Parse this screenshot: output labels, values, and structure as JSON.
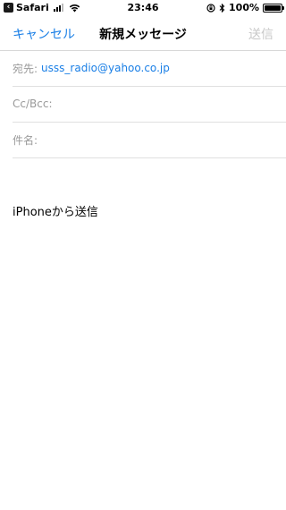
{
  "status_bar": {
    "back_app": "Safari",
    "time": "23:46",
    "battery": "100%"
  },
  "nav": {
    "cancel_label": "キャンセル",
    "title": "新規メッセージ",
    "send_label": "送信"
  },
  "fields": {
    "to_label": "宛先:",
    "to_value": "usss_radio@yahoo.co.jp",
    "cc_label": "Cc/Bcc:",
    "subject_label": "件名:"
  },
  "body": {
    "signature": "iPhoneから送信"
  },
  "colors": {
    "accent": "#1a7fe6",
    "disabled": "#c8c8c8",
    "label": "#9a9a9a"
  }
}
